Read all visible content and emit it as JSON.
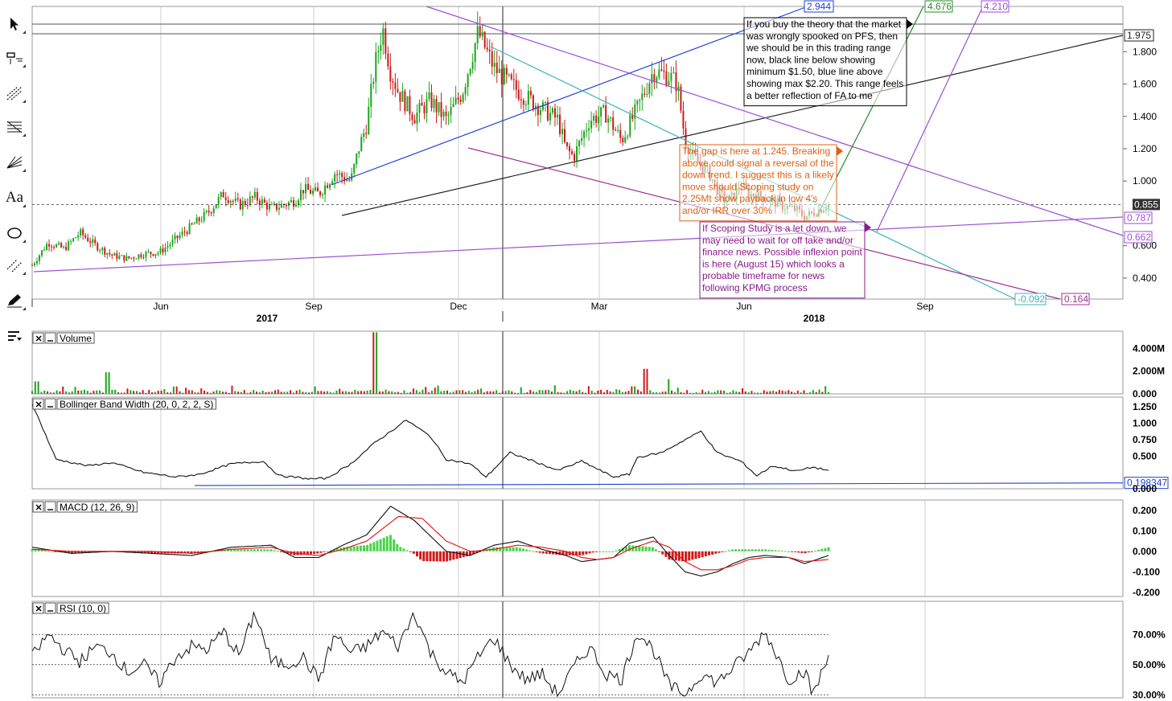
{
  "toolbar": [
    {
      "name": "cursor-tool-icon",
      "glyph": "arrow"
    },
    {
      "name": "crosshair-tool-icon",
      "glyph": "crosshair"
    },
    {
      "name": "trendline-tool-icon",
      "glyph": "trend"
    },
    {
      "name": "fibonacci-tool-icon",
      "glyph": "fib"
    },
    {
      "name": "gann-fan-tool-icon",
      "glyph": "fan"
    },
    {
      "name": "text-tool-icon",
      "glyph": "Aa"
    },
    {
      "name": "ellipse-tool-icon",
      "glyph": "ellipse"
    },
    {
      "name": "channel-tool-icon",
      "glyph": "channel"
    },
    {
      "name": "pencil-tool-icon",
      "glyph": "pencil"
    },
    {
      "name": "indicators-menu-icon",
      "glyph": "menu"
    }
  ],
  "chart_data": [
    {
      "type": "candlestick",
      "pane": "price",
      "x_start": "2016-03",
      "x_end": "2018-10",
      "x_ticks": [
        "Jun",
        "2017",
        "Sep",
        "Dec",
        "Mar",
        "Jun",
        "2018",
        "Sep"
      ],
      "y_ticks": [
        "1.800",
        "1.600",
        "1.400",
        "1.200",
        "1.000",
        "0.600",
        "0.400"
      ],
      "ylim": [
        0.27,
        2.08
      ],
      "last_price": "0.855",
      "price_path": [
        [
          0,
          0.48
        ],
        [
          0.02,
          0.62
        ],
        [
          0.04,
          0.58
        ],
        [
          0.06,
          0.68
        ],
        [
          0.08,
          0.6
        ],
        [
          0.1,
          0.54
        ],
        [
          0.12,
          0.52
        ],
        [
          0.14,
          0.55
        ],
        [
          0.16,
          0.56
        ],
        [
          0.18,
          0.64
        ],
        [
          0.2,
          0.72
        ],
        [
          0.22,
          0.8
        ],
        [
          0.24,
          0.92
        ],
        [
          0.26,
          0.85
        ],
        [
          0.28,
          0.9
        ],
        [
          0.3,
          0.83
        ],
        [
          0.32,
          0.86
        ],
        [
          0.33,
          0.88
        ],
        [
          0.34,
          0.95
        ],
        [
          0.36,
          0.92
        ],
        [
          0.38,
          1.05
        ],
        [
          0.4,
          1.0
        ],
        [
          0.41,
          1.2
        ],
        [
          0.42,
          1.35
        ],
        [
          0.43,
          1.7
        ],
        [
          0.44,
          1.95
        ],
        [
          0.45,
          1.68
        ],
        [
          0.46,
          1.55
        ],
        [
          0.48,
          1.4
        ],
        [
          0.5,
          1.5
        ],
        [
          0.52,
          1.38
        ],
        [
          0.54,
          1.55
        ],
        [
          0.56,
          1.92
        ],
        [
          0.58,
          1.7
        ],
        [
          0.6,
          1.6
        ],
        [
          0.62,
          1.52
        ],
        [
          0.64,
          1.45
        ],
        [
          0.66,
          1.38
        ],
        [
          0.67,
          1.2
        ],
        [
          0.68,
          1.15
        ],
        [
          0.7,
          1.38
        ],
        [
          0.72,
          1.42
        ],
        [
          0.74,
          1.25
        ],
        [
          0.76,
          1.45
        ],
        [
          0.78,
          1.68
        ],
        [
          0.8,
          1.65
        ],
        [
          0.81,
          1.6
        ],
        [
          0.82,
          1.25
        ],
        [
          0.83,
          1.15
        ],
        [
          0.85,
          1.05
        ],
        [
          0.86,
          0.95
        ],
        [
          0.87,
          0.88
        ],
        [
          0.88,
          0.9
        ],
        [
          0.89,
          0.98
        ],
        [
          0.9,
          0.92
        ],
        [
          0.92,
          0.9
        ],
        [
          0.94,
          0.85
        ],
        [
          0.96,
          0.82
        ],
        [
          0.97,
          0.78
        ],
        [
          0.98,
          0.8
        ],
        [
          1.0,
          0.855
        ]
      ]
    },
    {
      "type": "bar",
      "pane": "volume",
      "title": "Volume",
      "y_ticks": [
        "4.000M",
        "2.000M",
        "0.000"
      ],
      "ylim": [
        0,
        5500000
      ],
      "spikes": [
        [
          0.005,
          1100000
        ],
        [
          0.095,
          1900000
        ],
        [
          0.43,
          5400000
        ],
        [
          0.77,
          2200000
        ],
        [
          0.8,
          1300000
        ]
      ]
    },
    {
      "type": "line",
      "pane": "bbw",
      "title": "Bollinger Band Width (20, 0, 2, 2, S)",
      "y_ticks": [
        "1.250",
        "1.000",
        "0.750",
        "0.500",
        "0.000"
      ],
      "ylim": [
        0,
        1.4
      ],
      "support_value": "0.198347",
      "values": [
        [
          0,
          1.3
        ],
        [
          0.03,
          0.45
        ],
        [
          0.07,
          0.35
        ],
        [
          0.1,
          0.4
        ],
        [
          0.14,
          0.25
        ],
        [
          0.18,
          0.18
        ],
        [
          0.21,
          0.22
        ],
        [
          0.25,
          0.38
        ],
        [
          0.29,
          0.42
        ],
        [
          0.31,
          0.2
        ],
        [
          0.35,
          0.15
        ],
        [
          0.37,
          0.16
        ],
        [
          0.4,
          0.38
        ],
        [
          0.43,
          0.7
        ],
        [
          0.47,
          1.05
        ],
        [
          0.5,
          0.8
        ],
        [
          0.52,
          0.45
        ],
        [
          0.55,
          0.38
        ],
        [
          0.57,
          0.18
        ],
        [
          0.6,
          0.55
        ],
        [
          0.63,
          0.42
        ],
        [
          0.66,
          0.28
        ],
        [
          0.69,
          0.42
        ],
        [
          0.71,
          0.3
        ],
        [
          0.73,
          0.18
        ],
        [
          0.75,
          0.22
        ],
        [
          0.76,
          0.48
        ],
        [
          0.79,
          0.55
        ],
        [
          0.82,
          0.75
        ],
        [
          0.84,
          0.88
        ],
        [
          0.86,
          0.55
        ],
        [
          0.89,
          0.42
        ],
        [
          0.91,
          0.2
        ],
        [
          0.93,
          0.35
        ],
        [
          0.96,
          0.27
        ],
        [
          0.98,
          0.33
        ],
        [
          1.0,
          0.28
        ]
      ]
    },
    {
      "type": "line",
      "pane": "macd",
      "title": "MACD (12, 26, 9)",
      "y_ticks": [
        "0.200",
        "0.100",
        "0.000",
        "-0.100",
        "-0.200"
      ],
      "ylim": [
        -0.22,
        0.25
      ],
      "macd": [
        [
          0,
          0.02
        ],
        [
          0.05,
          -0.01
        ],
        [
          0.1,
          0.0
        ],
        [
          0.15,
          -0.01
        ],
        [
          0.2,
          -0.02
        ],
        [
          0.25,
          0.02
        ],
        [
          0.3,
          0.03
        ],
        [
          0.33,
          -0.03
        ],
        [
          0.36,
          -0.03
        ],
        [
          0.39,
          0.03
        ],
        [
          0.42,
          0.08
        ],
        [
          0.45,
          0.22
        ],
        [
          0.48,
          0.15
        ],
        [
          0.52,
          0.0
        ],
        [
          0.55,
          -0.02
        ],
        [
          0.58,
          0.03
        ],
        [
          0.61,
          0.05
        ],
        [
          0.64,
          0.01
        ],
        [
          0.67,
          -0.02
        ],
        [
          0.69,
          -0.05
        ],
        [
          0.71,
          -0.04
        ],
        [
          0.73,
          -0.03
        ],
        [
          0.75,
          0.04
        ],
        [
          0.78,
          0.07
        ],
        [
          0.8,
          -0.02
        ],
        [
          0.82,
          -0.1
        ],
        [
          0.84,
          -0.12
        ],
        [
          0.86,
          -0.1
        ],
        [
          0.88,
          -0.06
        ],
        [
          0.9,
          -0.03
        ],
        [
          0.92,
          -0.02
        ],
        [
          0.95,
          -0.03
        ],
        [
          0.97,
          -0.06
        ],
        [
          1.0,
          -0.02
        ]
      ],
      "signal": [
        [
          0,
          0.01
        ],
        [
          0.05,
          0.0
        ],
        [
          0.1,
          0.0
        ],
        [
          0.15,
          0.0
        ],
        [
          0.2,
          -0.01
        ],
        [
          0.25,
          0.01
        ],
        [
          0.3,
          0.02
        ],
        [
          0.33,
          -0.01
        ],
        [
          0.36,
          -0.02
        ],
        [
          0.39,
          0.01
        ],
        [
          0.42,
          0.05
        ],
        [
          0.46,
          0.17
        ],
        [
          0.49,
          0.16
        ],
        [
          0.52,
          0.05
        ],
        [
          0.55,
          0.0
        ],
        [
          0.58,
          0.01
        ],
        [
          0.61,
          0.03
        ],
        [
          0.64,
          0.02
        ],
        [
          0.67,
          0.0
        ],
        [
          0.69,
          -0.03
        ],
        [
          0.71,
          -0.04
        ],
        [
          0.73,
          -0.03
        ],
        [
          0.75,
          0.01
        ],
        [
          0.78,
          0.05
        ],
        [
          0.8,
          0.02
        ],
        [
          0.82,
          -0.05
        ],
        [
          0.84,
          -0.09
        ],
        [
          0.86,
          -0.09
        ],
        [
          0.88,
          -0.07
        ],
        [
          0.9,
          -0.04
        ],
        [
          0.92,
          -0.03
        ],
        [
          0.95,
          -0.03
        ],
        [
          0.97,
          -0.05
        ],
        [
          1.0,
          -0.04
        ]
      ]
    },
    {
      "type": "line",
      "pane": "rsi",
      "title": "RSI (10, 0)",
      "y_ticks": [
        "70.00%",
        "50.00%",
        "30.00%"
      ],
      "ylim": [
        28,
        92
      ],
      "values": [
        [
          0,
          55
        ],
        [
          0.02,
          70
        ],
        [
          0.04,
          60
        ],
        [
          0.06,
          52
        ],
        [
          0.08,
          62
        ],
        [
          0.1,
          58
        ],
        [
          0.12,
          45
        ],
        [
          0.14,
          50
        ],
        [
          0.16,
          38
        ],
        [
          0.18,
          55
        ],
        [
          0.2,
          62
        ],
        [
          0.22,
          60
        ],
        [
          0.24,
          72
        ],
        [
          0.26,
          56
        ],
        [
          0.28,
          85
        ],
        [
          0.3,
          52
        ],
        [
          0.32,
          50
        ],
        [
          0.34,
          55
        ],
        [
          0.36,
          40
        ],
        [
          0.38,
          70
        ],
        [
          0.4,
          58
        ],
        [
          0.42,
          62
        ],
        [
          0.44,
          72
        ],
        [
          0.46,
          62
        ],
        [
          0.48,
          85
        ],
        [
          0.5,
          58
        ],
        [
          0.52,
          45
        ],
        [
          0.54,
          38
        ],
        [
          0.56,
          55
        ],
        [
          0.58,
          68
        ],
        [
          0.6,
          50
        ],
        [
          0.62,
          40
        ],
        [
          0.64,
          44
        ],
        [
          0.66,
          30
        ],
        [
          0.68,
          48
        ],
        [
          0.7,
          62
        ],
        [
          0.72,
          44
        ],
        [
          0.74,
          40
        ],
        [
          0.76,
          72
        ],
        [
          0.78,
          60
        ],
        [
          0.8,
          36
        ],
        [
          0.82,
          30
        ],
        [
          0.84,
          44
        ],
        [
          0.86,
          38
        ],
        [
          0.88,
          48
        ],
        [
          0.9,
          58
        ],
        [
          0.92,
          72
        ],
        [
          0.93,
          62
        ],
        [
          0.95,
          40
        ],
        [
          0.97,
          46
        ],
        [
          0.98,
          30
        ],
        [
          1.0,
          55
        ]
      ]
    }
  ],
  "drawings": {
    "blue_trend_label": "2.944",
    "green_label": "4.676",
    "purple_top_label": "4.210",
    "black_trend_label": "1.975",
    "purple_support_label": "0.787",
    "purple_down_label": "0.662",
    "teal_label": "-0.092",
    "magenta_label": "0.164"
  },
  "notes": [
    {
      "name": "note-trading-range",
      "color": "#000000",
      "lines": [
        "If you buy the theory that the market",
        "was wrongly spooked on PFS, then",
        "we should be in this trading range",
        "now, black line below showing",
        "minimum $1.50, blue line above",
        "showing max $2.20. This range feels",
        "a better reflection of FA to me"
      ]
    },
    {
      "name": "note-gap",
      "color": "#e06010",
      "lines": [
        "The gap is here at 1.245. Breaking",
        "above could signal a reversal of the",
        "down trend. I suggest this is a likely",
        "move should Scoping study on",
        "2.25Mt show payback in low 4's",
        "and/or IRR over 30%"
      ]
    },
    {
      "name": "note-scoping",
      "color": "#8a1a8a",
      "lines": [
        "If Scoping Study is a let down, we",
        "may need to wait for off take and/or",
        "finance news. Possible inflexion point",
        "is here (August 15) which looks a",
        "probable timeframe for news",
        "following KPMG process"
      ]
    }
  ],
  "colors": {
    "up": "#1aa51a",
    "down": "#cc1a1a",
    "blue_line": "#1f3fd6",
    "black_line": "#222222",
    "purple_line": "#9b4fd6",
    "teal_line": "#3fb5b5",
    "magenta_line": "#a0309a",
    "green_line": "#2a8a2a",
    "grid": "#bbbbbb"
  }
}
